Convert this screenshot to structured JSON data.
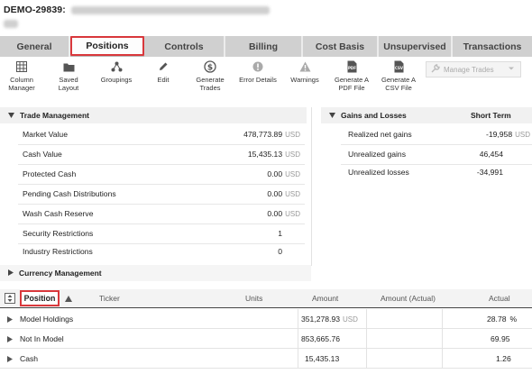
{
  "header": {
    "account_id": "DEMO-29839:"
  },
  "tabs": [
    {
      "label": "General",
      "active": false
    },
    {
      "label": "Positions",
      "active": true
    },
    {
      "label": "Controls",
      "active": false
    },
    {
      "label": "Billing",
      "active": false
    },
    {
      "label": "Cost Basis",
      "active": false
    },
    {
      "label": "Unsupervised",
      "active": false
    },
    {
      "label": "Transactions",
      "active": false
    }
  ],
  "toolbar": {
    "buttons": [
      {
        "label": "Column\nManager",
        "icon": "grid-icon"
      },
      {
        "label": "Saved\nLayout",
        "icon": "folder-icon"
      },
      {
        "label": "Groupings",
        "icon": "network-icon"
      },
      {
        "label": "Edit",
        "icon": "pencil-icon"
      },
      {
        "label": "Generate\nTrades",
        "icon": "dollar-cycle-icon"
      },
      {
        "label": "Error Details",
        "icon": "error-icon"
      },
      {
        "label": "Warnings",
        "icon": "warning-icon"
      },
      {
        "label": "Generate A\nPDF File",
        "icon": "pdf-file-icon"
      },
      {
        "label": "Generate A\nCSV File",
        "icon": "csv-file-icon"
      }
    ],
    "manage_trades": "Manage Trades"
  },
  "trade_management": {
    "title": "Trade Management",
    "rows": [
      {
        "label": "Market Value",
        "value": "478,773.89",
        "unit": "USD"
      },
      {
        "label": "Cash Value",
        "value": "15,435.13",
        "unit": "USD"
      },
      {
        "label": "Protected Cash",
        "value": "0.00",
        "unit": "USD"
      },
      {
        "label": "Pending Cash Distributions",
        "value": "0.00",
        "unit": "USD"
      },
      {
        "label": "Wash Cash Reserve",
        "value": "0.00",
        "unit": "USD"
      },
      {
        "label": "Security Restrictions",
        "value": "1",
        "unit": ""
      },
      {
        "label": "Industry Restrictions",
        "value": "0",
        "unit": ""
      }
    ]
  },
  "gains_losses": {
    "title": "Gains and Losses",
    "column": "Short Term",
    "rows": [
      {
        "label": "Realized net gains",
        "value": "-19,958",
        "unit": "USD"
      },
      {
        "label": "Unrealized gains",
        "value": "46,454",
        "unit": ""
      },
      {
        "label": "Unrealized losses",
        "value": "-34,991",
        "unit": ""
      }
    ]
  },
  "currency_management": {
    "title": "Currency Management"
  },
  "grid": {
    "columns": {
      "position": "Position",
      "ticker": "Ticker",
      "units": "Units",
      "amount": "Amount",
      "amount_actual": "Amount (Actual)",
      "actual": "Actual"
    },
    "rows": [
      {
        "position": "Model Holdings",
        "amount": "351,278.93",
        "amount_unit": "USD",
        "actual": "28.78",
        "actual_unit": "%"
      },
      {
        "position": "Not In Model",
        "amount": "853,665.76",
        "amount_unit": "",
        "actual": "69.95",
        "actual_unit": ""
      },
      {
        "position": "Cash",
        "amount": "15,435.13",
        "amount_unit": "",
        "actual": "1.26",
        "actual_unit": ""
      }
    ]
  },
  "colors": {
    "highlight": "#d9383c",
    "tab_bg": "#d0d0d0",
    "section_bg": "#f1f1f1"
  }
}
